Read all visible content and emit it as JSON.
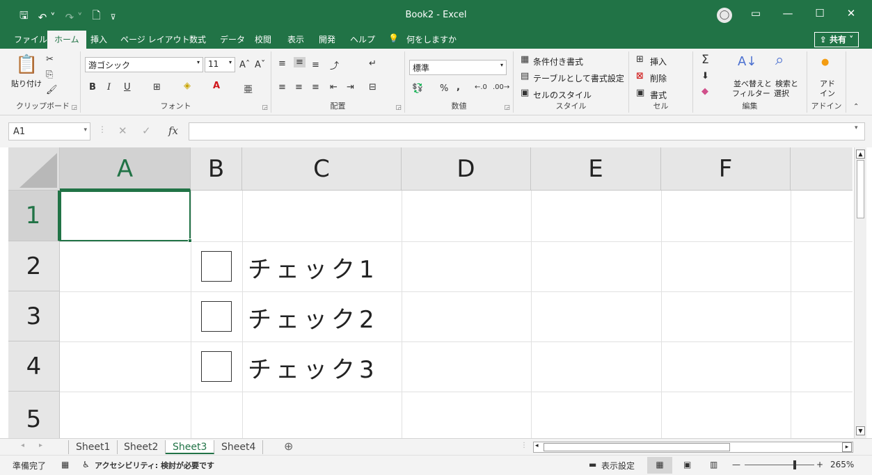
{
  "titlebar": {
    "title": "Book2  -  Excel",
    "qat": [
      "save-icon",
      "undo-icon",
      "redo-icon",
      "new-icon",
      "customize-icon"
    ],
    "avatar_glyph": "◯",
    "window_buttons": [
      "▭",
      "—",
      "☐",
      "✕"
    ]
  },
  "tabs": {
    "items": [
      "ファイル",
      "ホーム",
      "挿入",
      "ページ レイアウト",
      "数式",
      "データ",
      "校閲",
      "表示",
      "開発",
      "ヘルプ"
    ],
    "tell_me": "何をしますか",
    "share": "共有"
  },
  "ribbon": {
    "clipboard": {
      "paste": "貼り付け",
      "label": "クリップボード"
    },
    "font": {
      "name": "游ゴシック",
      "size": "11",
      "bold": "B",
      "italic": "I",
      "underline": "U",
      "label": "フォント"
    },
    "alignment": {
      "label": "配置"
    },
    "number": {
      "format": "標準",
      "percent": "%",
      "comma": ",",
      "label": "数値"
    },
    "styles": {
      "conditional": "条件付き書式",
      "as_table": "テーブルとして書式設定",
      "cell_styles": "セルのスタイル",
      "label": "スタイル"
    },
    "cells": {
      "insert": "挿入",
      "delete": "削除",
      "format": "書式",
      "label": "セル"
    },
    "editing": {
      "sum": "Σ",
      "sort_filter_1": "並べ替えと",
      "sort_filter_2": "フィルター",
      "find_1": "検索と",
      "find_2": "選択",
      "label": "編集"
    },
    "addins": {
      "addin_1": "アド",
      "addin_2": "イン",
      "label": "アドイン"
    }
  },
  "formula_bar": {
    "name_box": "A1",
    "fx": "fx",
    "value": ""
  },
  "grid": {
    "columns": [
      "A",
      "B",
      "C",
      "D",
      "E",
      "F",
      "("
    ],
    "rows": [
      "1",
      "2",
      "3",
      "4",
      "5"
    ],
    "checkboxes": [
      {
        "label": "チェック1",
        "checked": false
      },
      {
        "label": "チェック2",
        "checked": false
      },
      {
        "label": "チェック3",
        "checked": false
      }
    ]
  },
  "sheets": {
    "tabs": [
      "Sheet1",
      "Sheet2",
      "Sheet3",
      "Sheet4"
    ],
    "active": "Sheet3",
    "add": "⊕"
  },
  "status": {
    "ready": "準備完了",
    "accessibility": "アクセシビリティ: 検討が必要です",
    "display_settings": "表示設定",
    "zoom": "265%",
    "zoom_minus": "—",
    "zoom_plus": "+"
  },
  "colors": {
    "accent": "#217346",
    "ribbon_bg": "#f3f3f3"
  }
}
